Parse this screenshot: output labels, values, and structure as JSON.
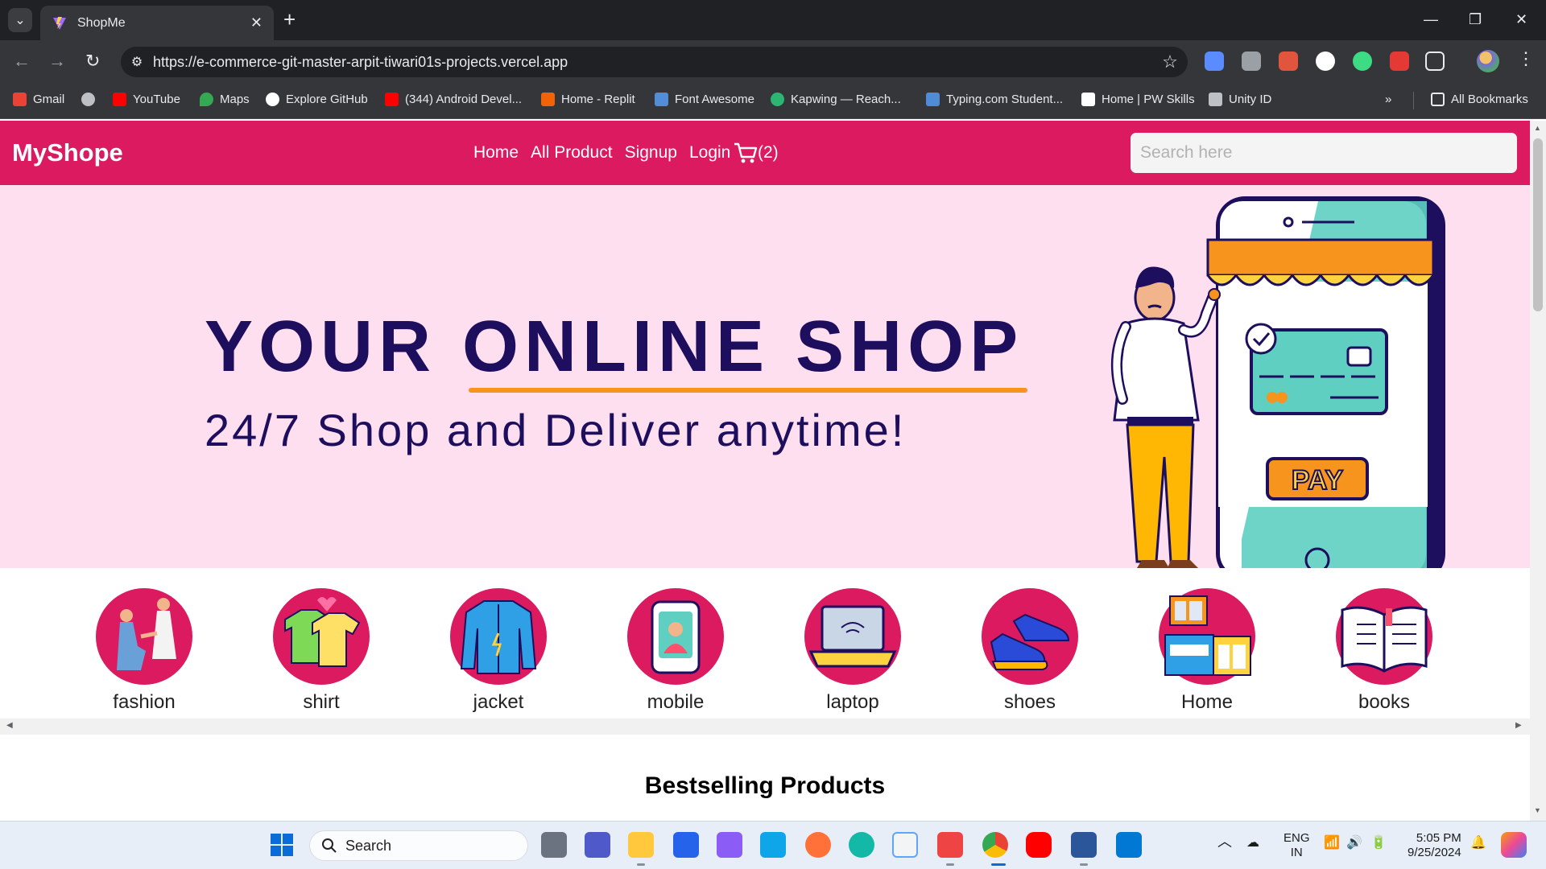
{
  "browser": {
    "tab_title": "ShopMe",
    "url": "https://e-commerce-git-master-arpit-tiwari01s-projects.vercel.app",
    "bookmarks": [
      {
        "label": "Gmail",
        "icon": "gmail-icon",
        "color": "#ea4335"
      },
      {
        "label": "",
        "icon": "globe-icon",
        "color": "#bdc1c6"
      },
      {
        "label": "YouTube",
        "icon": "youtube-icon",
        "color": "#ff0000"
      },
      {
        "label": "Maps",
        "icon": "maps-icon",
        "color": "#34a853"
      },
      {
        "label": "Explore GitHub",
        "icon": "github-icon",
        "color": "#ffffff"
      },
      {
        "label": "(344) Android Devel...",
        "icon": "youtube-icon",
        "color": "#ff0000"
      },
      {
        "label": "Home - Replit",
        "icon": "replit-icon",
        "color": "#f26207"
      },
      {
        "label": "Font Awesome",
        "icon": "font-awesome-icon",
        "color": "#538dd7"
      },
      {
        "label": "Kapwing — Reach...",
        "icon": "kapwing-icon",
        "color": "#2bb673"
      },
      {
        "label": "Typing.com Student...",
        "icon": "typing-icon",
        "color": "#4f8bd6"
      },
      {
        "label": "Home | PW Skills",
        "icon": "pw-skills-icon",
        "color": "#ffffff"
      },
      {
        "label": "Unity ID",
        "icon": "unity-icon",
        "color": "#bdc1c6"
      }
    ],
    "all_bookmarks": "All Bookmarks"
  },
  "site": {
    "brand": "MyShope",
    "nav": [
      "Home",
      "All Product",
      "Signup",
      "Login"
    ],
    "cart_count": "(2)",
    "search_placeholder": "Search here",
    "accent": "#db1a5f"
  },
  "hero": {
    "title_part1": "YOUR ",
    "title_part2": "ONLINE SHOP",
    "subtitle": "24/7 Shop and Deliver anytime!",
    "pay_label": "PAY",
    "bg": "#fedfef",
    "text_color": "#1e0e5e",
    "underline_color": "#f7941d"
  },
  "categories": [
    {
      "label": "fashion",
      "icon": "couple-icon"
    },
    {
      "label": "shirt",
      "icon": "tshirt-icon"
    },
    {
      "label": "jacket",
      "icon": "jacket-icon"
    },
    {
      "label": "mobile",
      "icon": "mobile-icon"
    },
    {
      "label": "laptop",
      "icon": "laptop-icon"
    },
    {
      "label": "shoes",
      "icon": "shoes-icon"
    },
    {
      "label": "Home",
      "icon": "furniture-icon"
    },
    {
      "label": "books",
      "icon": "book-icon"
    }
  ],
  "section_title": "Bestselling Products",
  "taskbar": {
    "search_label": "Search",
    "lang": "ENG",
    "region": "IN",
    "time": "5:05 PM",
    "date": "9/25/2024"
  }
}
